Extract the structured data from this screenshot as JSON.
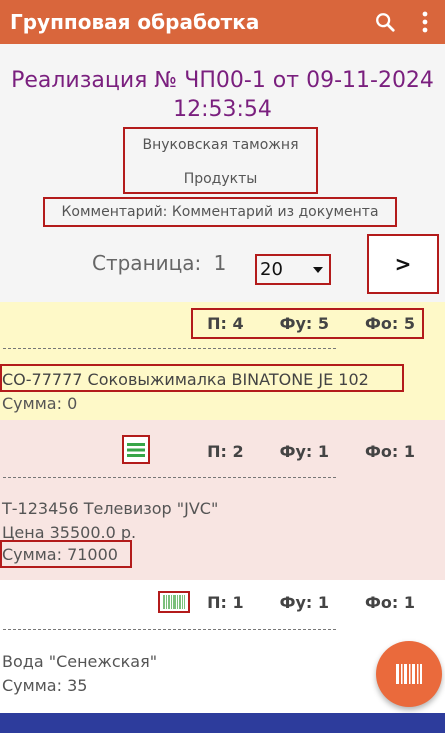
{
  "appbar": {
    "title": "Групповая обработка",
    "search_icon": "search-icon",
    "menu_icon": "more-vert-icon"
  },
  "document": {
    "title_line1": "Реализация № ЧП00-1 от 09-11-2024",
    "title_line2": "12:53:54",
    "customs": "Внуковская таможня",
    "category": "Продукты",
    "comment": "Комментарий: Комментарий из документа"
  },
  "pager": {
    "label": "Страница:",
    "page": "1",
    "page_size": "20",
    "next_label": ">"
  },
  "items": [
    {
      "p": "П: 4",
      "fu": "Фу: 5",
      "fo": "Фо: 5",
      "name": "СО-77777 Соковыжималка BINATONE JE 102",
      "sum": "Сумма: 0",
      "bg": "#fef9c8"
    },
    {
      "icon": "list-lines-icon",
      "p": "П: 2",
      "fu": "Фу: 1",
      "fo": "Фо: 1",
      "name": "Т-123456 Телевизор \"JVC\"",
      "price": "Цена 35500.0 р.",
      "sum": "Сумма: 71000",
      "bg": "#f8e5e2"
    },
    {
      "icon": "barcode-icon",
      "p": "П: 1",
      "fu": "Фу: 1",
      "fo": "Фо: 1",
      "name": "Вода \"Сенежская\"",
      "sum": "Сумма: 35",
      "bg": "#ffffff"
    }
  ],
  "fab": {
    "icon": "barcode-scan-icon"
  },
  "colors": {
    "accent": "#d9663c",
    "title": "#7a1f7e",
    "highlight": "#b31b1b",
    "nav": "#2d3c9c"
  }
}
